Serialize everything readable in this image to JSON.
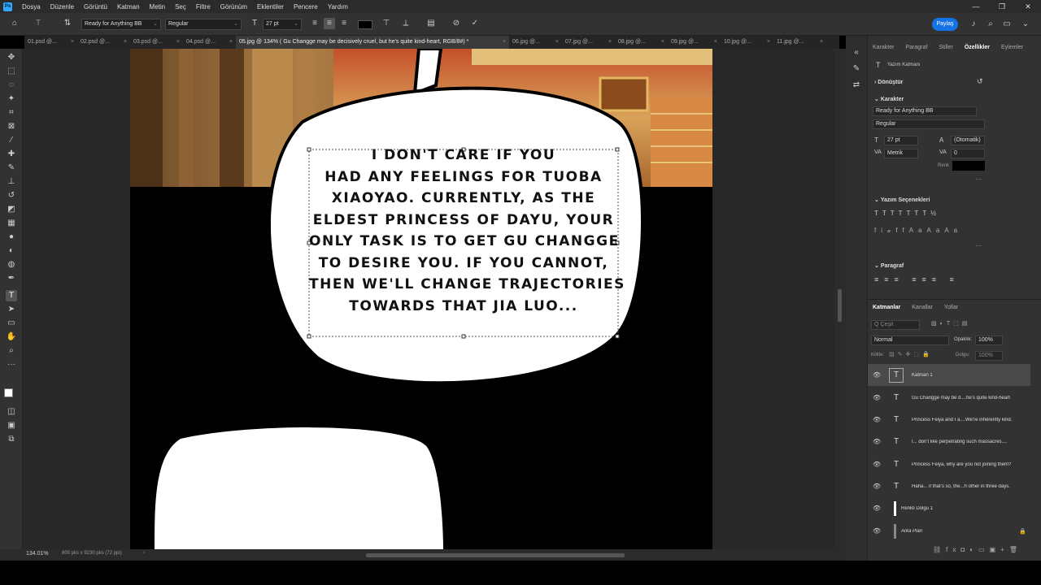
{
  "menu": {
    "app_icon": "Ps",
    "items": [
      "Dosya",
      "Düzenle",
      "Görüntü",
      "Katman",
      "Metin",
      "Seç",
      "Filtre",
      "Görünüm",
      "Eklentiler",
      "Pencere",
      "Yardım"
    ]
  },
  "options": {
    "font_family": "Ready for Anything BB",
    "font_style": "Regular",
    "font_size": "27 pt",
    "share_button": "Paylaş"
  },
  "tabs": [
    {
      "label": "01.psd @..."
    },
    {
      "label": "02.psd @..."
    },
    {
      "label": "03.psd @..."
    },
    {
      "label": "04.psd @..."
    },
    {
      "label": "05.jpg @ 134% ( Gu Changge may be  decisively cruel, but he's quite kind-heart, RGB/8#) *"
    },
    {
      "label": "06.jpg @..."
    },
    {
      "label": "07.jpg @..."
    },
    {
      "label": "08.jpg @..."
    },
    {
      "label": "09.jpg @..."
    },
    {
      "label": "10.jpg @..."
    },
    {
      "label": "11.jpg @..."
    }
  ],
  "canvas": {
    "speech_text": "I DON'T CARE IF YOU\nHAD ANY FEELINGS FOR TUOBA\nXIAOYAO. CURRENTLY, AS THE\nELDEST PRINCESS OF DAYU, YOUR\nONLY TASK IS TO GET GU CHANGGE\nTO DESIRE YOU. IF YOU CANNOT,\nTHEN WE'LL CHANGE TRAJECTORIES\nTOWARDS THAT JIA LUO..."
  },
  "status": {
    "zoom": "134.01%",
    "doc_size": "800 pks x 9230 pks (72 ppi)"
  },
  "properties_panel": {
    "tabs": [
      "Karakter",
      "Paragraf",
      "Stiller",
      "Özellikler",
      "Eylemler"
    ],
    "active_tab": "Özellikler",
    "layer_kind": "Yazım Katmanı",
    "transform_section": "Dönüştür",
    "character_section": "Karakter",
    "font_family": "Ready for Anything BB",
    "font_style": "Regular",
    "font_size": "27 pt",
    "leading": "(Otomatik)",
    "kerning": "Metrik",
    "tracking": "0",
    "color_label": "Renk",
    "text_options_section": "Yazım Seçenekleri",
    "paragraph_section": "Paragraf"
  },
  "layers_panel": {
    "tabs": [
      "Katmanlar",
      "Kanallar",
      "Yollar"
    ],
    "filter_placeholder": "Q Çeşit",
    "blend_mode": "Normal",
    "opacity_label": "Opaklık:",
    "opacity_value": "100%",
    "lock_label": "Kilitle:",
    "fill_label": "Dolgu:",
    "fill_value": "100%",
    "layers": [
      {
        "name": "Katman 1",
        "type": "T"
      },
      {
        "name": "Gu Changge may be  d....he's quite kind-heart",
        "type": "T"
      },
      {
        "name": "Princess Feiya  and I a....We're inherently kind.",
        "type": "T"
      },
      {
        "name": "I... don't like  perpetrating such massacres....",
        "type": "T"
      },
      {
        "name": "Princess Feiya, why are you not joining them?",
        "type": "T"
      },
      {
        "name": "Haha... if that's so, the...h other in three days.",
        "type": "T"
      },
      {
        "name": "Renkli Dolgu 1",
        "type": "fill"
      },
      {
        "name": "Arka Plan",
        "type": "bg"
      }
    ]
  },
  "colors": {
    "accent": "#1473e6",
    "text_color_swatch": "#000000",
    "ui_dark": "#323232"
  }
}
